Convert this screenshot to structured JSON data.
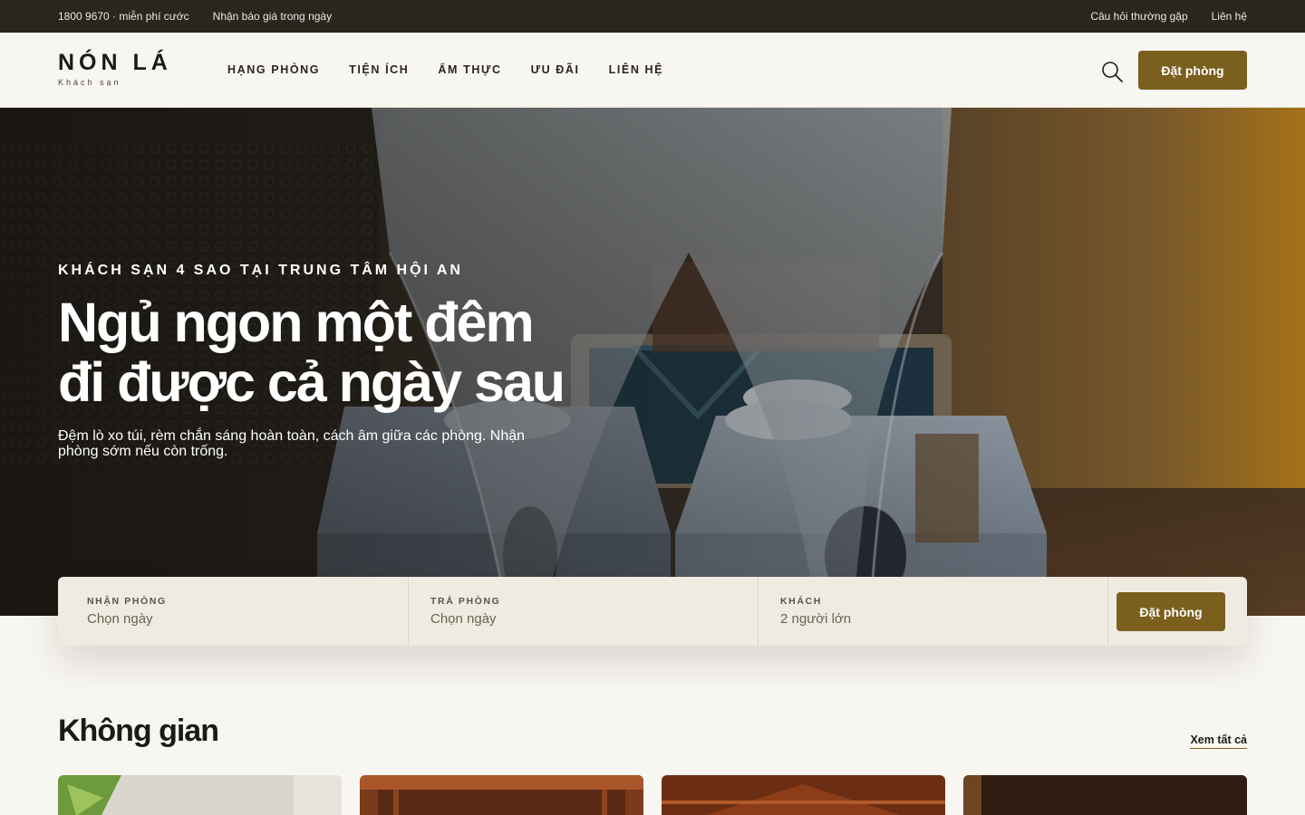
{
  "topbar": {
    "phone": "1800 9670 · miễn phí cước",
    "quote": "Nhận báo giá trong ngày",
    "faq": "Câu hỏi thường gặp",
    "contact": "Liên hệ"
  },
  "brand": {
    "name": "NÓN LÁ",
    "tagline": "Khách sạn"
  },
  "nav": {
    "items": [
      "HẠNG PHÒNG",
      "TIỆN ÍCH",
      "ẨM THỰC",
      "ƯU ĐÃI",
      "LIÊN HỆ"
    ]
  },
  "header": {
    "book_label": "Đặt phòng"
  },
  "hero": {
    "kicker": "KHÁCH SẠN 4 SAO TẠI TRUNG TÂM HỘI AN",
    "title_line1": "Ngủ ngon một đêm",
    "title_line2": "đi được cả ngày sau",
    "description": "Đệm lò xo túi, rèm chắn sáng hoàn toàn, cách âm giữa các phòng. Nhận phòng sớm nếu còn trống."
  },
  "booking": {
    "checkin_label": "NHẬN PHÒNG",
    "checkin_value": "Chọn ngày",
    "checkout_label": "TRẢ PHÒNG",
    "checkout_value": "Chọn ngày",
    "guests_label": "KHÁCH",
    "guests_value": "2 người lớn",
    "submit_label": "Đặt phòng"
  },
  "spaces": {
    "title": "Không gian",
    "see_all": "Xem tất cả"
  },
  "colors": {
    "accent": "#7a5f1e",
    "topbar_bg": "#2a251e",
    "page_bg": "#f8f6f1",
    "booking_bg": "#efebe1"
  },
  "icons": {
    "search": "search-icon"
  }
}
